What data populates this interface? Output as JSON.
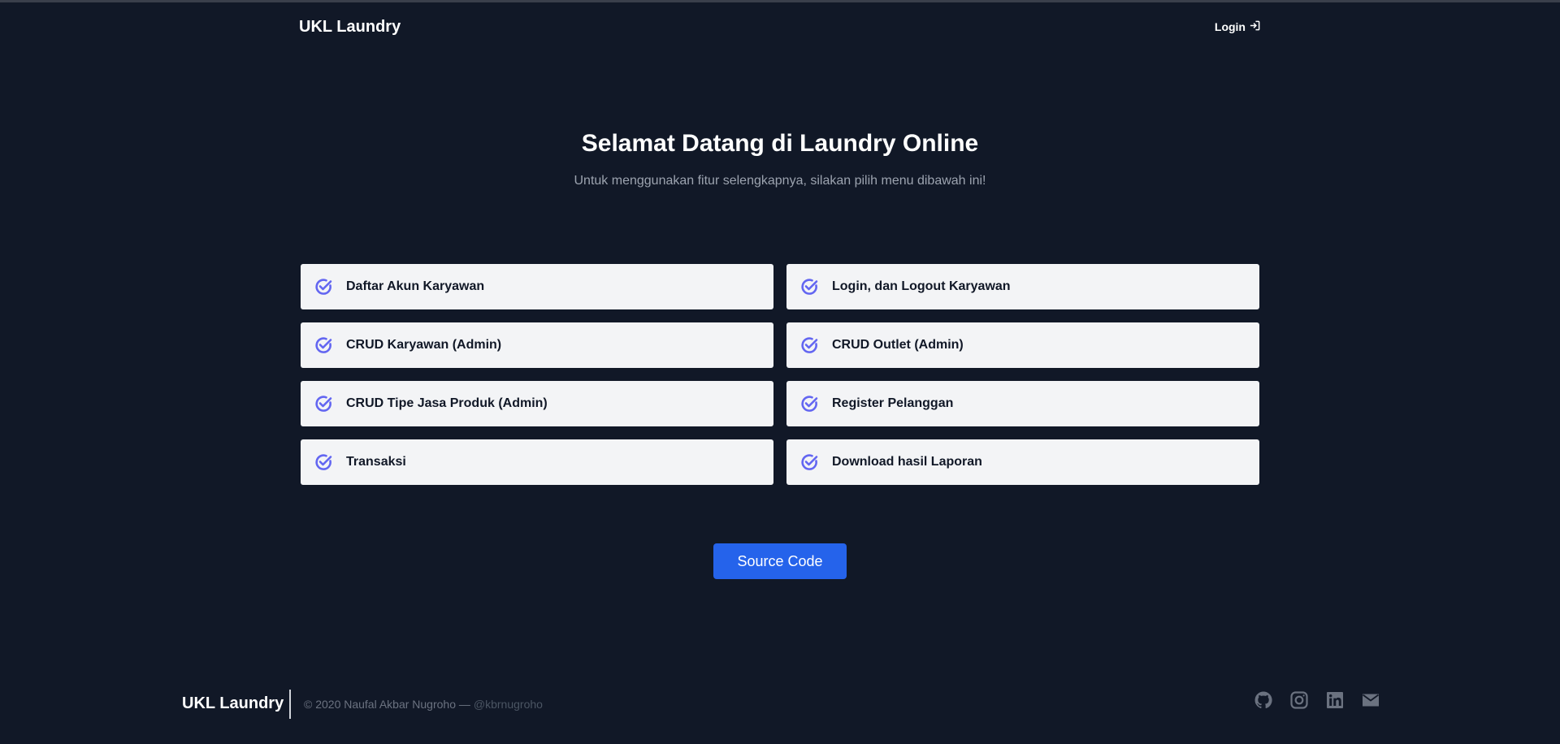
{
  "header": {
    "brand": "UKL Laundry",
    "login_label": "Login",
    "login_icon": "login-icon"
  },
  "hero": {
    "title": "Selamat Datang di Laundry Online",
    "subtitle": "Untuk menggunakan fitur selengkapnya, silakan pilih menu dibawah ini!"
  },
  "features": [
    {
      "label": "Daftar Akun Karyawan",
      "icon": "badge-check-icon"
    },
    {
      "label": "Login, dan Logout Karyawan",
      "icon": "badge-check-icon"
    },
    {
      "label": "CRUD Karyawan (Admin)",
      "icon": "badge-check-icon"
    },
    {
      "label": "CRUD Outlet (Admin)",
      "icon": "badge-check-icon"
    },
    {
      "label": "CRUD Tipe Jasa Produk (Admin)",
      "icon": "badge-check-icon"
    },
    {
      "label": "Register Pelanggan",
      "icon": "badge-check-icon"
    },
    {
      "label": "Transaksi",
      "icon": "badge-check-icon"
    },
    {
      "label": "Download hasil Laporan",
      "icon": "badge-check-icon"
    }
  ],
  "cta": {
    "label": "Source Code"
  },
  "footer": {
    "brand": "UKL Laundry",
    "copyright": "© 2020 Naufal Akbar Nugroho —",
    "handle": "@kbrnugroho",
    "socials": [
      "github-icon",
      "instagram-icon",
      "linkedin-icon",
      "mail-icon"
    ]
  },
  "colors": {
    "background": "#111827",
    "accent": "#2563eb",
    "check_icon": "#6366f1",
    "card": "#f3f4f6"
  }
}
